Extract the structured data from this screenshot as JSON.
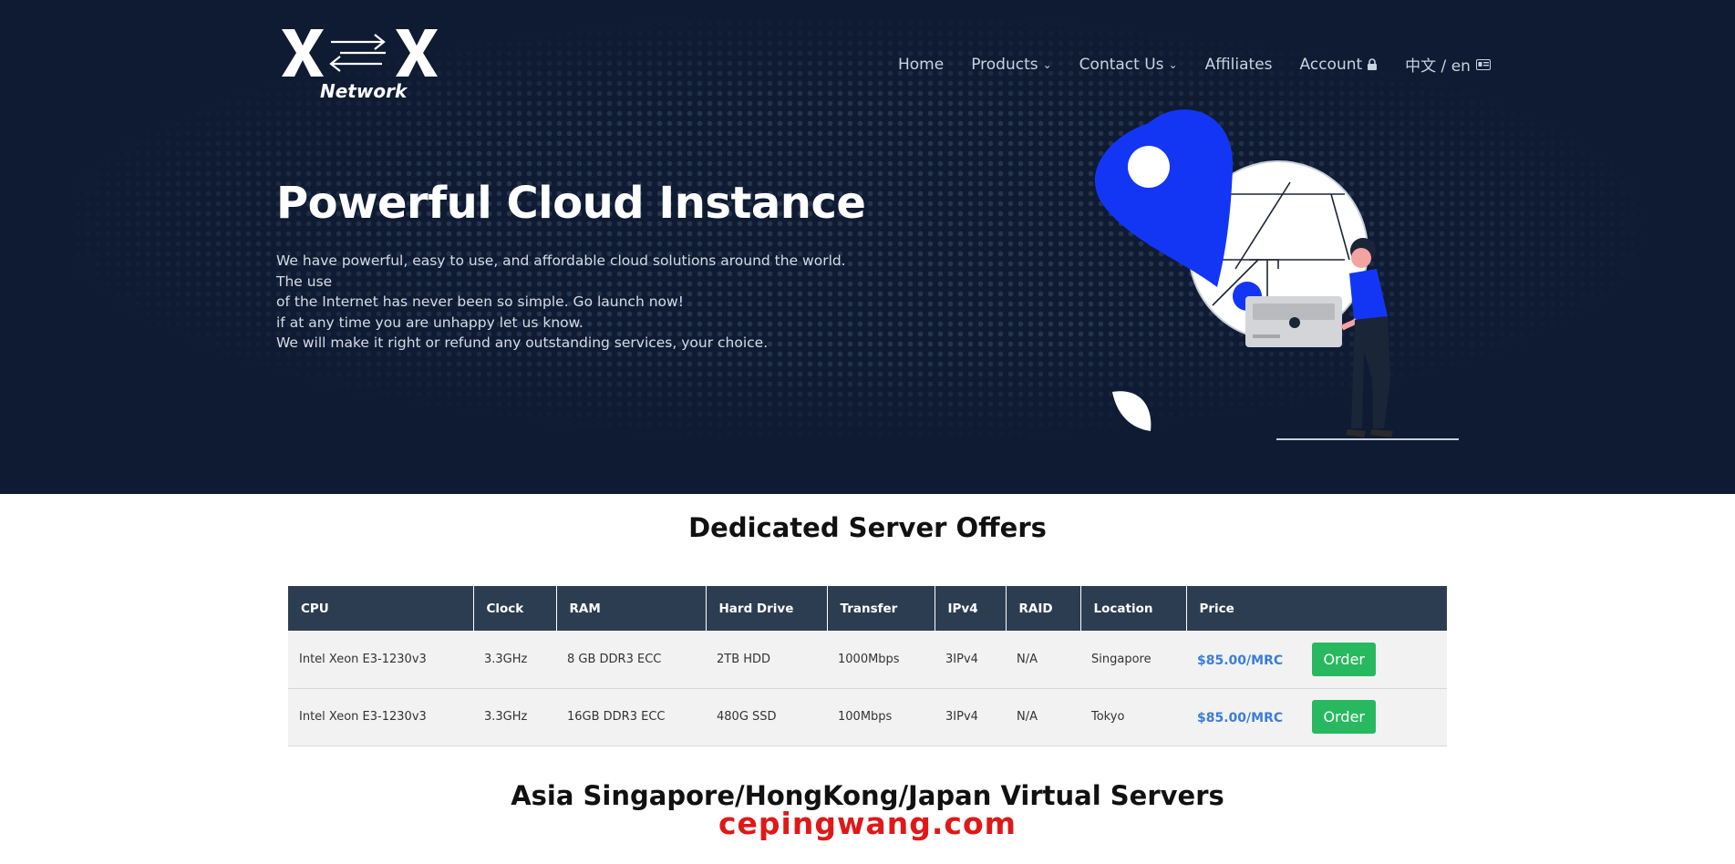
{
  "brand": {
    "logo_word": "Network",
    "colors": {
      "hero_bg": "#0f1b33",
      "table_header": "#2d3d51",
      "price": "#3b7dd8",
      "order_button": "#28b960",
      "accent_blue": "#1336f5"
    }
  },
  "nav": {
    "home": "Home",
    "products": "Products",
    "contact": "Contact Us",
    "affiliates": "Affiliates",
    "account": "Account",
    "language": "中文 / en",
    "caret_icon": "chevron-down-icon",
    "lock_icon": "lock-icon",
    "lang_icon": "language-card-icon"
  },
  "hero": {
    "title": "Powerful Cloud Instance",
    "lines": [
      "We have powerful, easy to use, and affordable cloud solutions around the world. The use",
      "of the Internet has never been so simple. Go launch now!",
      "if at any time you are unhappy let us know.",
      "We will make it right or refund any outstanding services, your choice."
    ]
  },
  "dedicated": {
    "title": "Dedicated Server Offers",
    "columns": [
      "CPU",
      "Clock",
      "RAM",
      "Hard Drive",
      "Transfer",
      "IPv4",
      "RAID",
      "Location",
      "Price",
      ""
    ],
    "rows": [
      {
        "cpu": "Intel Xeon E3-1230v3",
        "clock": "3.3GHz",
        "ram": "8 GB DDR3 ECC",
        "drive": "2TB HDD",
        "transfer": "1000Mbps",
        "ipv4": "3IPv4",
        "raid": "N/A",
        "location": "Singapore",
        "price": "$85.00/MRC",
        "action": "Order"
      },
      {
        "cpu": "Intel Xeon E3-1230v3",
        "clock": "3.3GHz",
        "ram": "16GB DDR3 ECC",
        "drive": "480G SSD",
        "transfer": "100Mbps",
        "ipv4": "3IPv4",
        "raid": "N/A",
        "location": "Tokyo",
        "price": "$85.00/MRC",
        "action": "Order"
      }
    ]
  },
  "virtual": {
    "title": "Asia Singapore/HongKong/Japan Virtual Servers"
  },
  "watermark": "cepingwang.com"
}
